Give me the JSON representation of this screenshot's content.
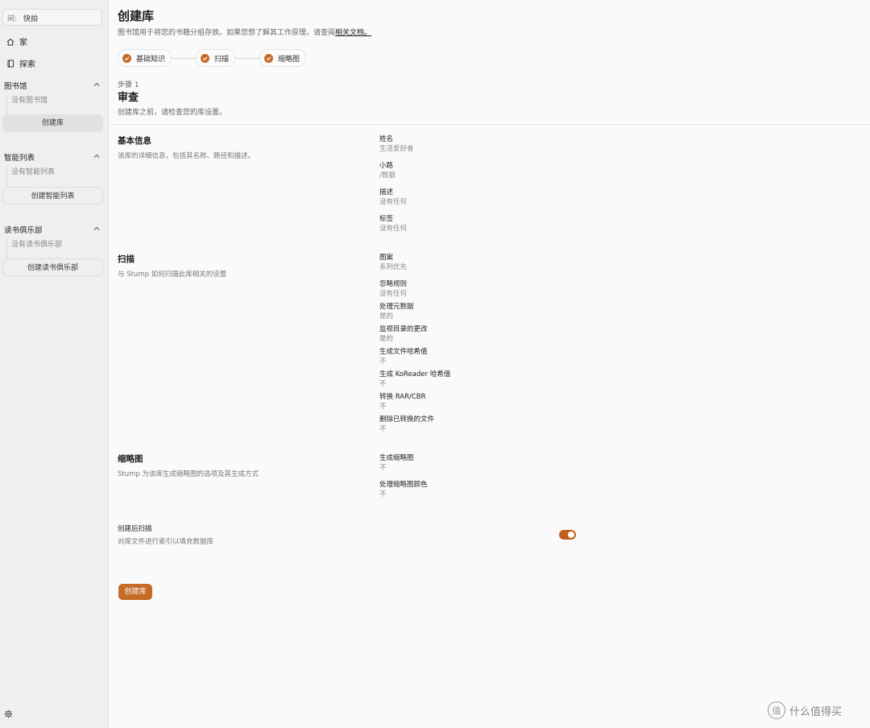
{
  "sidebar": {
    "search_prefix": "问:",
    "search_value": "快拍",
    "nav": [
      {
        "label": "家",
        "icon": "home-icon"
      },
      {
        "label": "探索",
        "icon": "book-icon"
      }
    ],
    "sections": [
      {
        "title": "图书馆",
        "empty": "没有图书馆",
        "button": "创建库"
      },
      {
        "title": "智能列表",
        "empty": "没有智能列表",
        "button": "创建智能列表"
      },
      {
        "title": "读书俱乐部",
        "empty": "没有读书俱乐部",
        "button": "创建读书俱乐部"
      }
    ]
  },
  "header": {
    "title": "创建库",
    "desc_prefix": "图书馆用于将您的书籍分组存放。如果您想了解其工作原理，请查阅",
    "desc_link": "相关文档。"
  },
  "steps": [
    "基础知识",
    "扫描",
    "缩略图"
  ],
  "review": {
    "step_label": "步骤 1",
    "title": "审查",
    "desc": "创建库之前，请检查您的库设置。"
  },
  "basic": {
    "title": "基本信息",
    "desc": "该库的详细信息，包括其名称、路径和描述。",
    "fields": [
      {
        "label": "姓名",
        "value": "生活爱好者"
      },
      {
        "label": "小路",
        "value": "/数据"
      },
      {
        "label": "描述",
        "value": "没有任何"
      },
      {
        "label": "标签",
        "value": "没有任何"
      }
    ]
  },
  "scan": {
    "title": "扫描",
    "desc": "与 Stump 如何扫描此库相关的设置",
    "fields": [
      {
        "label": "图案",
        "value": "系列优先"
      },
      {
        "label": "忽略规则",
        "value": "没有任何"
      },
      {
        "label": "处理元数据",
        "value": "是的"
      },
      {
        "label": "监视目录的更改",
        "value": "是的"
      },
      {
        "label": "生成文件哈希值",
        "value": "不"
      },
      {
        "label": "生成 KoReader 哈希值",
        "value": "不"
      },
      {
        "label": "转换 RAR/CBR",
        "value": "不"
      },
      {
        "label": "删除已转换的文件",
        "value": "不"
      }
    ]
  },
  "thumb": {
    "title": "缩略图",
    "desc": "Stump 为该库生成缩略图的选项及其生成方式",
    "fields": [
      {
        "label": "生成缩略图",
        "value": "不"
      },
      {
        "label": "处理缩略图颜色",
        "value": "不"
      }
    ]
  },
  "scan_after": {
    "label": "创建后扫描",
    "desc": "对库文件进行索引以填充数据库",
    "enabled": true
  },
  "create_button": "创建库",
  "watermark": {
    "logo": "值",
    "text": "什么值得买"
  },
  "colors": {
    "accent": "#c56b28",
    "toggle": "#c05e1d"
  }
}
